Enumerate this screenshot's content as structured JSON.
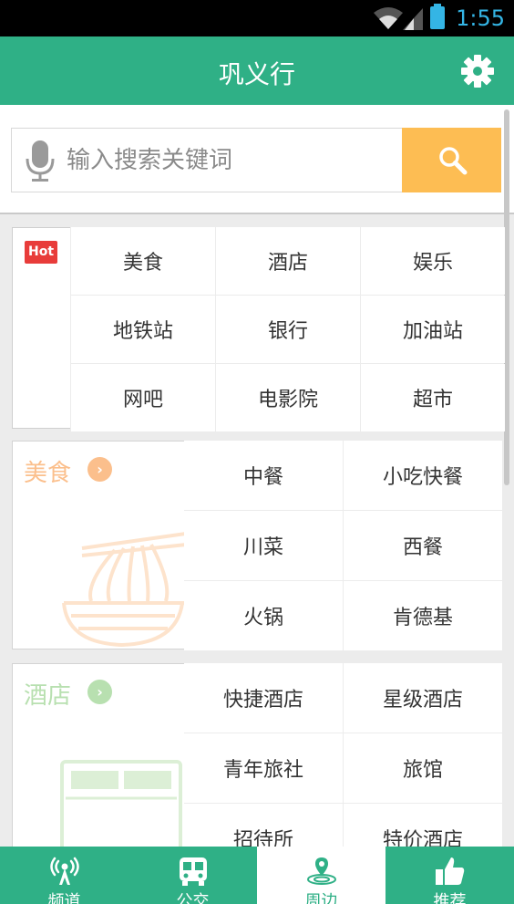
{
  "status_bar": {
    "time": "1:55"
  },
  "header": {
    "title": "巩义行",
    "settings_icon": "gear-icon"
  },
  "search": {
    "placeholder": "输入搜索关键词",
    "mic_icon": "microphone-icon",
    "button_icon": "search-icon"
  },
  "hot": {
    "badge": "Hot",
    "items": [
      "美食",
      "酒店",
      "娱乐",
      "地铁站",
      "银行",
      "加油站",
      "网吧",
      "电影院",
      "超市"
    ]
  },
  "food": {
    "title": "美食",
    "items": [
      "中餐",
      "小吃快餐",
      "川菜",
      "西餐",
      "火锅",
      "肯德基"
    ]
  },
  "hotel": {
    "title": "酒店",
    "items": [
      "快捷酒店",
      "星级酒店",
      "青年旅社",
      "旅馆",
      "招待所",
      "特价酒店"
    ]
  },
  "nav": {
    "items": [
      {
        "label": "频道",
        "icon": "radio-tower-icon"
      },
      {
        "label": "公交",
        "icon": "bus-icon"
      },
      {
        "label": "周边",
        "icon": "location-pin-icon"
      },
      {
        "label": "推荐",
        "icon": "thumbs-up-icon"
      }
    ],
    "active_index": 2
  },
  "colors": {
    "brand": "#2fb086",
    "search_button": "#fdbd53",
    "hot_badge": "#e83c3a",
    "food_accent": "#fbbf8c",
    "hotel_accent": "#b8e0b0"
  }
}
